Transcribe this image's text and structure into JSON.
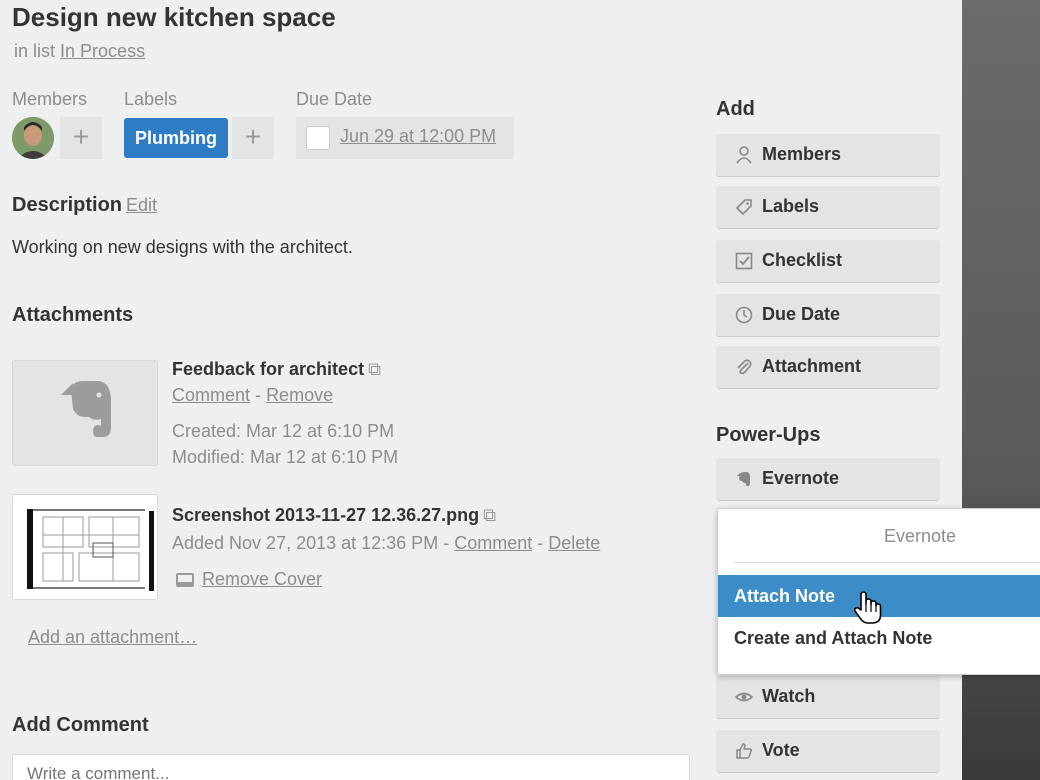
{
  "card": {
    "title": "Design new kitchen space",
    "in_list_prefix": "in list",
    "list_name": "In Process"
  },
  "members": {
    "heading": "Members",
    "add_symbol": "+"
  },
  "labels": {
    "heading": "Labels",
    "chip": "Plumbing",
    "chip_color": "#2e7cc3",
    "add_symbol": "+"
  },
  "due_date": {
    "heading": "Due Date",
    "value": "Jun 29 at 12:00 PM"
  },
  "description": {
    "heading": "Description",
    "edit_label": "Edit",
    "text": "Working on new designs with the architect."
  },
  "attachments": {
    "heading": "Attachments",
    "items": [
      {
        "name": "Feedback for architect",
        "comment": "Comment",
        "sep": "-",
        "remove": "Remove",
        "created": "Created: Mar 12 at 6:10 PM",
        "modified": "Modified: Mar 12 at 6:10 PM"
      },
      {
        "name": "Screenshot 2013-11-27 12.36.27.png",
        "added": "Added Nov 27, 2013 at 12:36 PM",
        "sep": "-",
        "comment": "Comment",
        "delete": "Delete",
        "remove_cover": "Remove Cover"
      }
    ],
    "add_link": "Add an attachment…"
  },
  "add_comment": {
    "heading": "Add Comment",
    "placeholder": "Write a comment..."
  },
  "sidebar": {
    "add_heading": "Add",
    "add_buttons": [
      {
        "label": "Members",
        "icon": "person-icon"
      },
      {
        "label": "Labels",
        "icon": "tag-icon"
      },
      {
        "label": "Checklist",
        "icon": "checkbox-icon"
      },
      {
        "label": "Due Date",
        "icon": "clock-icon"
      },
      {
        "label": "Attachment",
        "icon": "paperclip-icon"
      }
    ],
    "powerups_heading": "Power-Ups",
    "evernote_button": "Evernote",
    "watch_button": "Watch",
    "vote_button": "Vote"
  },
  "evernote_popup": {
    "title": "Evernote",
    "items": [
      "Attach Note",
      "Create and Attach Note"
    ],
    "active_color": "#3b8cc7"
  }
}
